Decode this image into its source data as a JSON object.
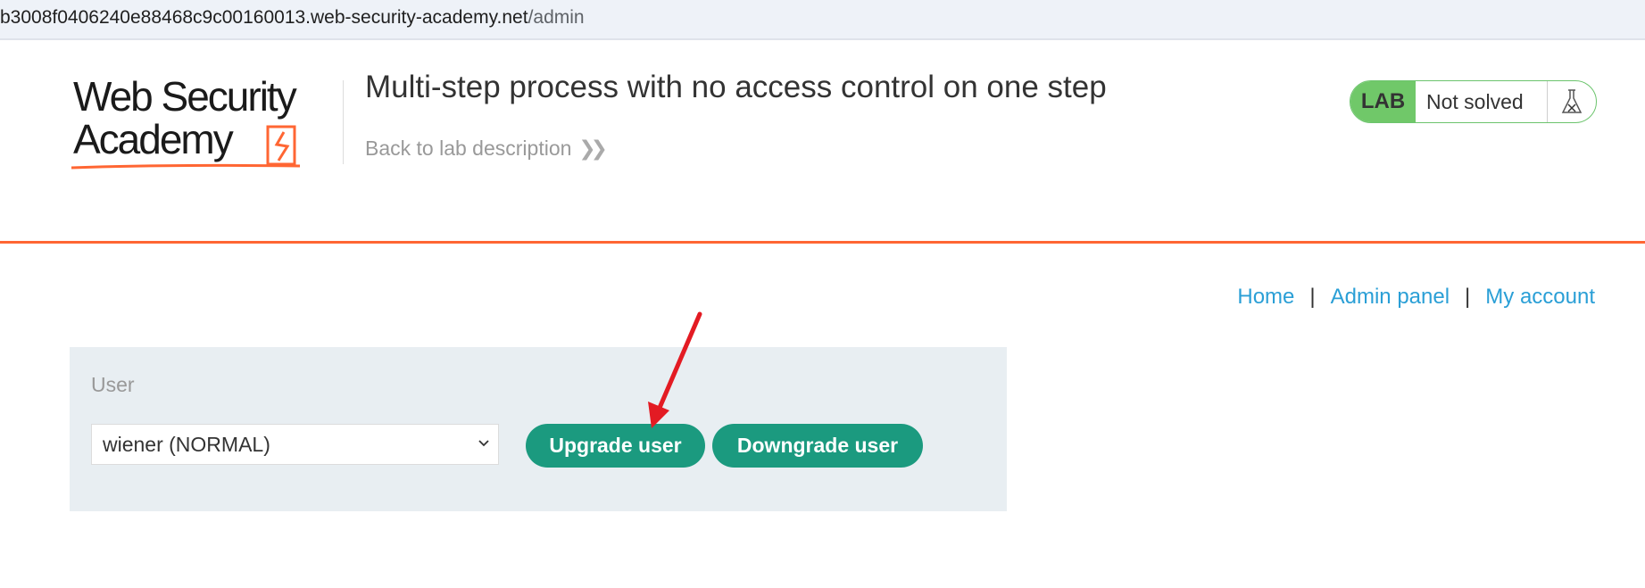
{
  "browser": {
    "url_host": "b3008f0406240e88468c9c00160013.web-security-academy.net",
    "url_path": "/admin"
  },
  "header": {
    "logo_line1": "Web Security",
    "logo_line2": "Academy",
    "lab_title": "Multi-step process with no access control on one step",
    "back_link": "Back to lab description",
    "status_badge": "LAB",
    "status_text": "Not solved"
  },
  "nav": {
    "home": "Home",
    "admin": "Admin panel",
    "account": "My account",
    "separator": "|"
  },
  "form": {
    "label": "User",
    "selected_user": "wiener (NORMAL)",
    "upgrade_label": "Upgrade user",
    "downgrade_label": "Downgrade user"
  },
  "colors": {
    "accent_orange": "#ff6633",
    "button_green": "#1b9a7f",
    "link_blue": "#2a9fd6",
    "lab_green": "#70c869"
  },
  "icons": [
    "flask-icon",
    "double-chevron-right-icon",
    "chevron-down-icon",
    "arrow-annotation"
  ]
}
